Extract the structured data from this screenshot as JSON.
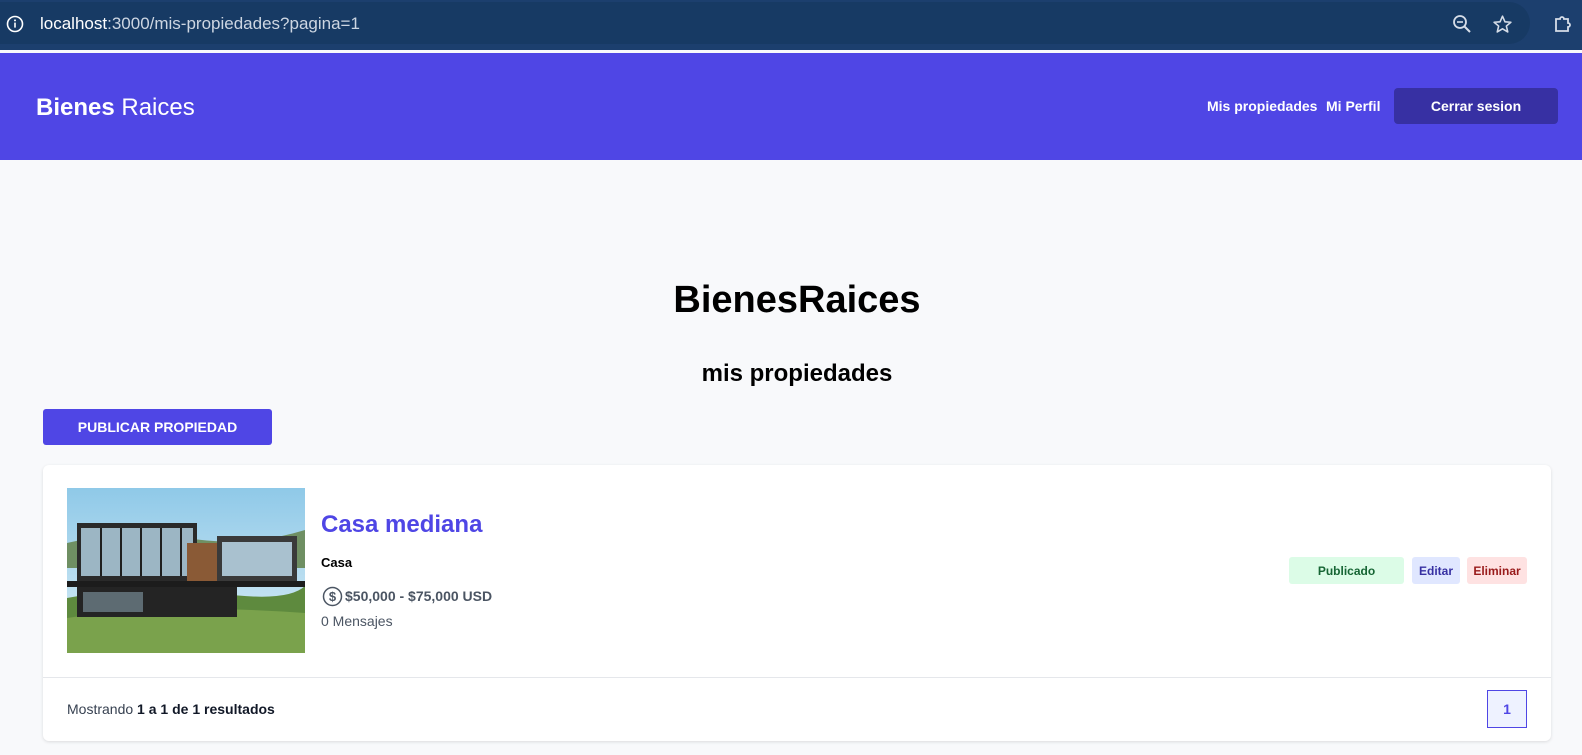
{
  "browser": {
    "url_host": "localhost",
    "url_path": ":3000/mis-propiedades?pagina=1"
  },
  "header": {
    "brand_bold": "Bienes",
    "brand_light": " Raices",
    "nav": {
      "properties": "Mis propiedades",
      "profile": "Mi Perfil",
      "logout": "Cerrar sesion"
    }
  },
  "main": {
    "title_bold": "Bienes",
    "title_light": "Raices",
    "heading": "mis propiedades",
    "publish_button": "PUBLICAR PROPIEDAD"
  },
  "properties": [
    {
      "title": "Casa mediana",
      "category": "Casa",
      "price": "$50,000 - $75,000 USD",
      "messages": "0 Mensajes",
      "status": "Publicado",
      "edit_label": "Editar",
      "delete_label": "Eliminar"
    }
  ],
  "pagination": {
    "prefix": "Mostrando ",
    "from": "1",
    "sep1": " a ",
    "to": "1",
    "sep2": " de ",
    "total": "1",
    "suffix": " resultados",
    "current_page": "1"
  },
  "colors": {
    "primary": "#4f46e5",
    "primary_dark": "#3730a3",
    "published_bg": "#dcfce7",
    "published_text": "#166534",
    "delete_bg": "#fee2e2",
    "delete_text": "#991b1b"
  }
}
